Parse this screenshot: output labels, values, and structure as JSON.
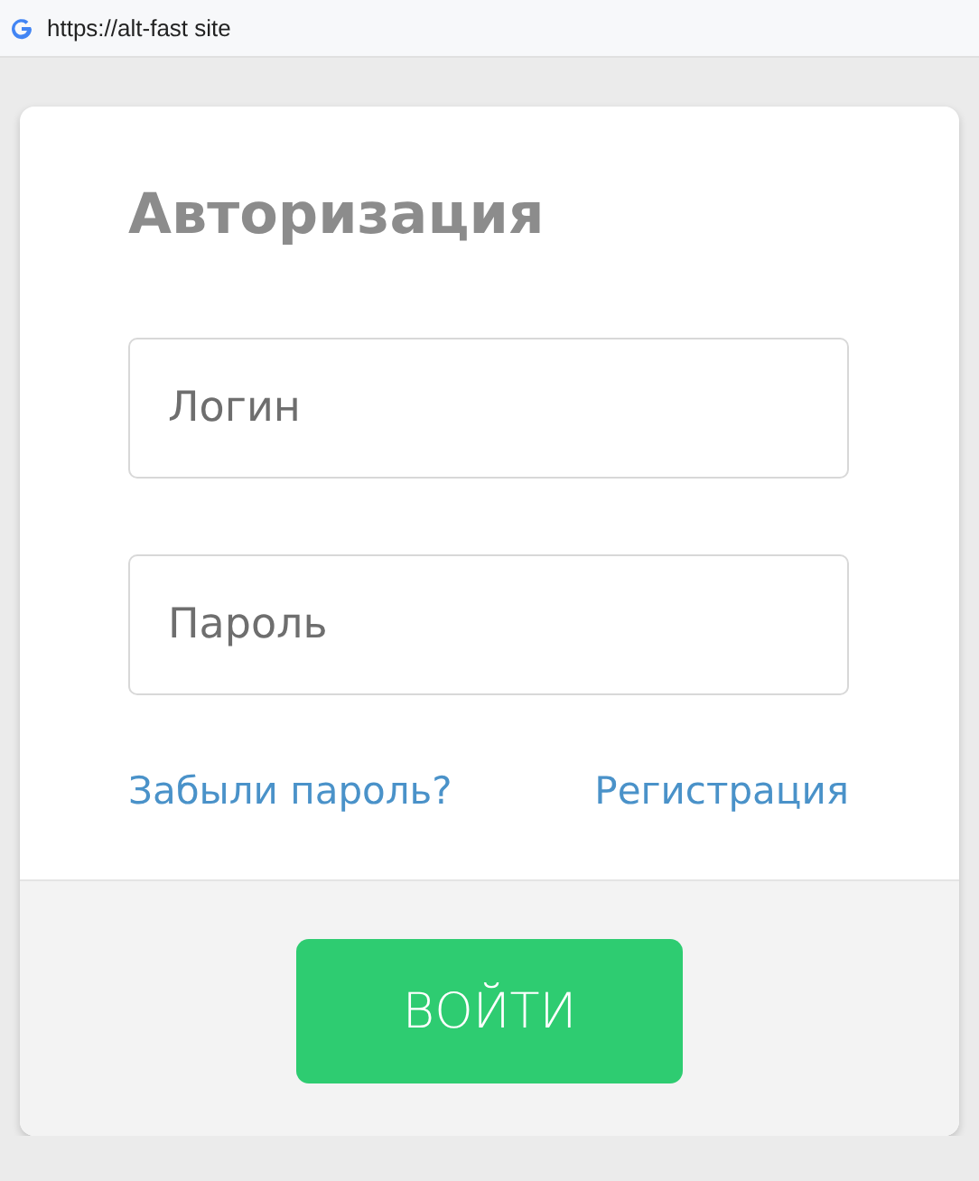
{
  "address_bar": {
    "url": "https://alt-fast site"
  },
  "form": {
    "title": "Авторизация",
    "fields": [
      {
        "placeholder": "Логин"
      },
      {
        "placeholder": "Пароль"
      }
    ],
    "links": [
      "Забыли пароль?",
      "Регистрация"
    ],
    "submit": "ВОЙТИ"
  }
}
